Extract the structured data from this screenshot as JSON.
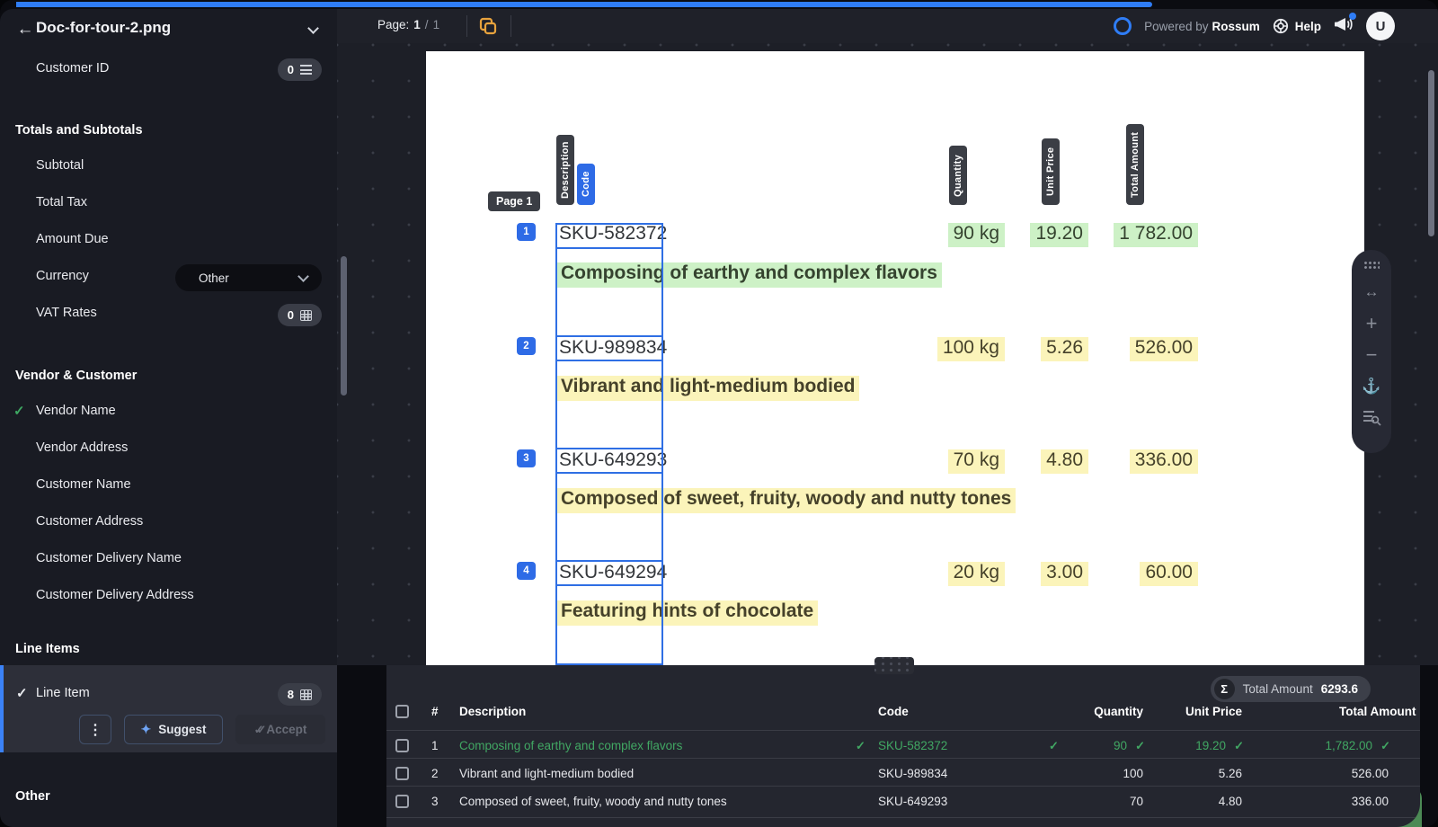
{
  "window": {
    "title": "Doc-for-tour-2.png"
  },
  "glyphs": {
    "back": "←",
    "check": "✓",
    "kebab": "⋮",
    "sigma": "Σ",
    "sparkle": "✦",
    "fit": "↔",
    "plus": "+",
    "minus": "−",
    "anchor": "⚓"
  },
  "colors": {
    "accent_blue": "#2e6be6",
    "progress_blue": "#2f7df6",
    "accepted_green": "#41a763",
    "highlight_green": "#cdf1c6",
    "highlight_yellow": "#fbf4ba",
    "brand_orange": "#e8a33d"
  },
  "sidebar": {
    "customer_id": {
      "label": "Customer ID",
      "count": "0"
    },
    "totals": {
      "heading": "Totals and Subtotals",
      "items": [
        "Subtotal",
        "Total Tax",
        "Amount Due"
      ],
      "currency_label": "Currency",
      "currency_value": "Other",
      "vat_label": "VAT Rates",
      "vat_count": "0"
    },
    "vendor": {
      "heading": "Vendor & Customer",
      "items": [
        {
          "label": "Vendor Name",
          "checked": true
        },
        {
          "label": "Vendor Address",
          "checked": false
        },
        {
          "label": "Customer Name",
          "checked": false
        },
        {
          "label": "Customer Address",
          "checked": false
        },
        {
          "label": "Customer Delivery Name",
          "checked": false
        },
        {
          "label": "Customer Delivery Address",
          "checked": false
        }
      ]
    },
    "line_items": {
      "heading": "Line Items",
      "item_label": "Line Item",
      "count": "8",
      "suggest_label": "Suggest",
      "accept_label": "Accept"
    },
    "other_heading": "Other"
  },
  "topbar": {
    "page_label": "Page:",
    "page_current": "1",
    "page_divider": "/",
    "page_total": "1",
    "powered_by": "Powered by",
    "brand": "Rossum",
    "help_label": "Help",
    "avatar_initial": "U"
  },
  "document": {
    "page_tag": "Page 1",
    "column_labels": {
      "description": "Description",
      "code": "Code",
      "quantity": "Quantity",
      "unit_price": "Unit Price",
      "total_amount": "Total Amount"
    },
    "rows": [
      {
        "num": "1",
        "code": "SKU-582372",
        "description": "Composing of earthy and complex flavors",
        "quantity": "90 kg",
        "unit_price": "19.20",
        "total": "1 782.00",
        "state": "accepted"
      },
      {
        "num": "2",
        "code": "SKU-989834",
        "description": "Vibrant and light-medium bodied",
        "quantity": "100 kg",
        "unit_price": "5.26",
        "total": "526.00",
        "state": "suggested"
      },
      {
        "num": "3",
        "code": "SKU-649293",
        "description": "Composed of sweet, fruity, woody and nutty tones",
        "quantity": "70 kg",
        "unit_price": "4.80",
        "total": "336.00",
        "state": "suggested"
      },
      {
        "num": "4",
        "code": "SKU-649294",
        "description": "Featuring hints of chocolate",
        "quantity": "20 kg",
        "unit_price": "3.00",
        "total": "60.00",
        "state": "suggested"
      }
    ]
  },
  "grid": {
    "total_badge": {
      "label": "Total Amount",
      "value": "6293.6"
    },
    "headers": {
      "index": "#",
      "description": "Description",
      "code": "Code",
      "quantity": "Quantity",
      "unit_price": "Unit Price",
      "total": "Total Amount"
    },
    "rows": [
      {
        "num": "1",
        "description": "Composing of earthy and complex flavors",
        "code": "SKU-582372",
        "quantity": "90",
        "unit_price": "19.20",
        "total": "1,782.00",
        "verified": true
      },
      {
        "num": "2",
        "description": "Vibrant and light-medium bodied",
        "code": "SKU-989834",
        "quantity": "100",
        "unit_price": "5.26",
        "total": "526.00",
        "verified": false
      },
      {
        "num": "3",
        "description": "Composed of sweet, fruity, woody and nutty tones",
        "code": "SKU-649293",
        "quantity": "70",
        "unit_price": "4.80",
        "total": "336.00",
        "verified": false
      }
    ]
  }
}
